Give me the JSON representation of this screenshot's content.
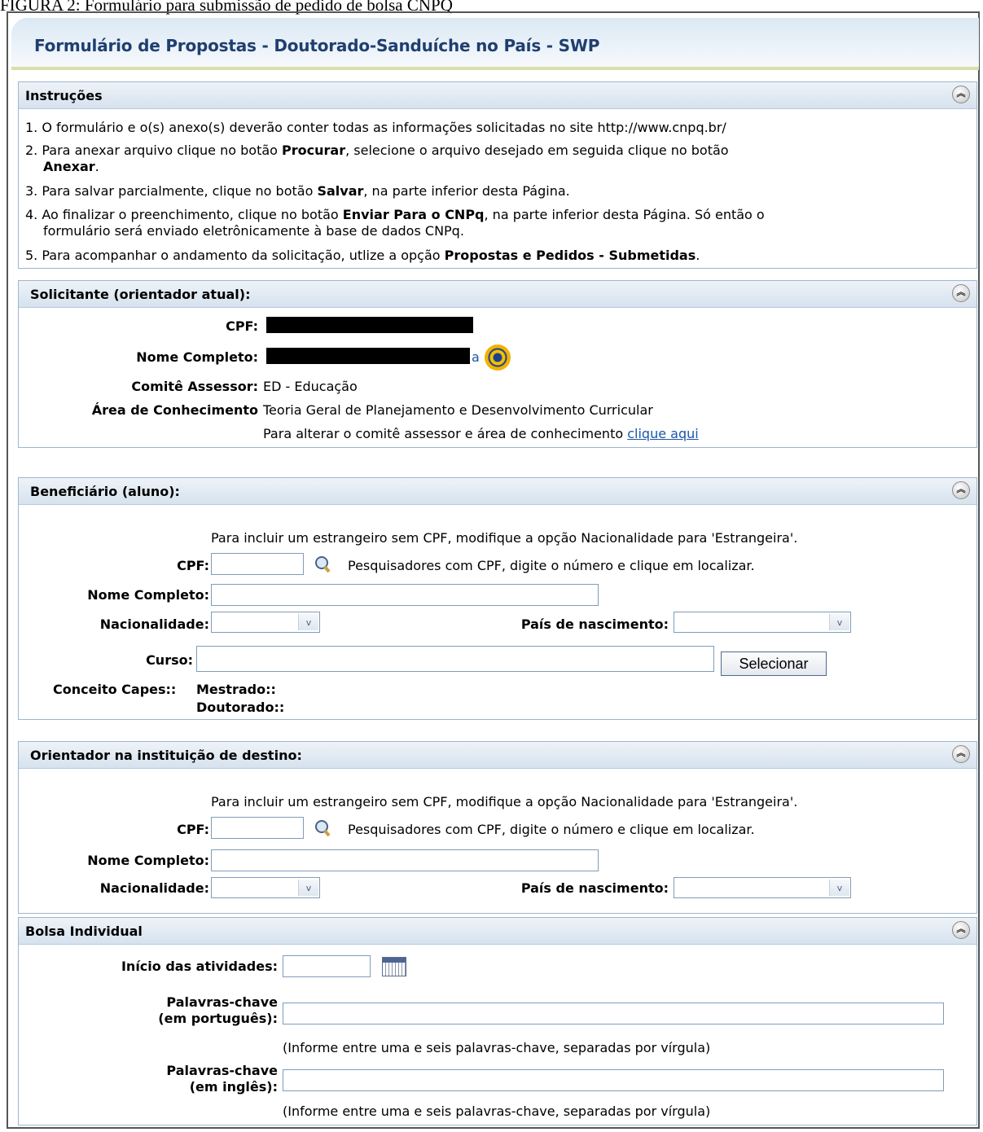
{
  "caption": "FIGURA 2: Formulário para submissão de pedido de bolsa CNPQ",
  "form_title": "Formulário de Propostas - Doutorado-Sanduíche no País - SWP",
  "instructions": {
    "title": "Instruções",
    "items": [
      {
        "n": "1.",
        "parts": [
          "O formulário e o(s) anexo(s) deverão conter todas as informações solicitadas no site http://www.cnpq.br/"
        ]
      },
      {
        "n": "2.",
        "line1": "Para anexar arquivo clique no botão ",
        "b1": "Procurar",
        "mid": ", selecione o arquivo desejado em seguida clique no botão",
        "b2": "Anexar",
        "end": "."
      },
      {
        "n": "3.",
        "pre": "Para salvar parcialmente, clique no botão ",
        "b": "Salvar",
        "post": ", na parte inferior desta Página."
      },
      {
        "n": "4.",
        "pre": "Ao finalizar o preenchimento, clique no botão ",
        "b": "Enviar Para o CNPq",
        "post": ", na parte inferior desta Página. Só então o",
        "line2": "formulário será enviado eletrônicamente à base de dados CNPq."
      },
      {
        "n": "5.",
        "pre": "Para acompanhar o andamento da solicitação, utlize a opção ",
        "b": "Propostas e Pedidos - Submetidas",
        "post": "."
      }
    ]
  },
  "solicitante": {
    "title": "Solicitante (orientador atual):",
    "cpf_label": "CPF:",
    "nome_label": "Nome Completo:",
    "nome_tail": "a",
    "comite_label": "Comitê Assessor:",
    "comite_value": "ED - Educação",
    "area_label": "Área de Conhecimento",
    "area_value": "Teoria Geral de Planejamento e Desenvolvimento Curricular",
    "alter_text": "Para alterar o comitê assessor e área de conhecimento ",
    "alter_link": "clique aqui"
  },
  "beneficiario": {
    "title": "Beneficiário (aluno):",
    "estrangeiro_hint": "Para incluir um estrangeiro sem CPF, modifique a opção Nacionalidade para 'Estrangeira'.",
    "cpf_label": "CPF:",
    "cpf_hint": "Pesquisadores com CPF, digite o número e clique em localizar.",
    "nome_label": "Nome Completo:",
    "nacionalidade_label": "Nacionalidade:",
    "pais_label": "País de nascimento:",
    "curso_label": "Curso:",
    "selecionar_button": "Selecionar",
    "conceito_label": "Conceito Capes::",
    "mestrado_label": "Mestrado::",
    "doutorado_label": "Doutorado::"
  },
  "orientador": {
    "title": "Orientador na instituição de destino:",
    "estrangeiro_hint": "Para incluir um estrangeiro sem CPF, modifique a opção Nacionalidade para 'Estrangeira'.",
    "cpf_label": "CPF:",
    "cpf_hint": "Pesquisadores com CPF, digite o número e clique em localizar.",
    "nome_label": "Nome Completo:",
    "nacionalidade_label": "Nacionalidade:",
    "pais_label": "País de nascimento:"
  },
  "bolsa": {
    "title": "Bolsa Individual",
    "inicio_label": "Início das atividades:",
    "kw_pt_label1": "Palavras-chave",
    "kw_pt_label2": "(em português):",
    "kw_hint": "(Informe entre uma e seis palavras-chave, separadas por vírgula)",
    "kw_en_label1": "Palavras-chave",
    "kw_en_label2": "(em inglês):"
  },
  "icons": {
    "collapse": "double-chevron-up-icon",
    "search": "magnifier-icon",
    "calendar": "calendar-icon",
    "lattes": "lattes-icon"
  }
}
